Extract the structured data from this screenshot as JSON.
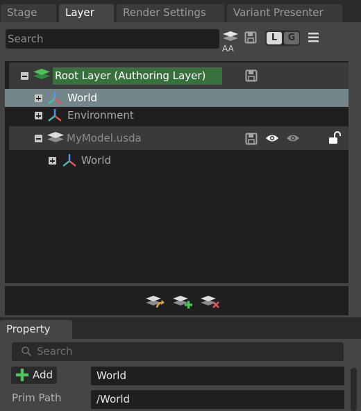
{
  "tabs": [
    {
      "label": "Stage"
    },
    {
      "label": "Layer"
    },
    {
      "label": "Render Settings"
    },
    {
      "label": "Variant Presenter"
    }
  ],
  "layer_toolbar": {
    "search_placeholder": "Search",
    "auto_authoring_label": "AA",
    "local_label": "L",
    "global_label": "G"
  },
  "tree": {
    "root_layer_label": "Root Layer (Authoring Layer)",
    "root_children": [
      {
        "label": "World"
      },
      {
        "label": "Environment"
      }
    ],
    "sublayer_label": "MyModel.usda",
    "sublayer_children": [
      {
        "label": "World"
      }
    ]
  },
  "property": {
    "tab_label": "Property",
    "search_placeholder": "Search",
    "add_label": "Add",
    "name_value": "World",
    "prim_path_label": "Prim Path",
    "prim_path_value": "/World"
  },
  "colors": {
    "authoring_layer_highlight": "#38713e",
    "selection_row": "#73878a"
  }
}
